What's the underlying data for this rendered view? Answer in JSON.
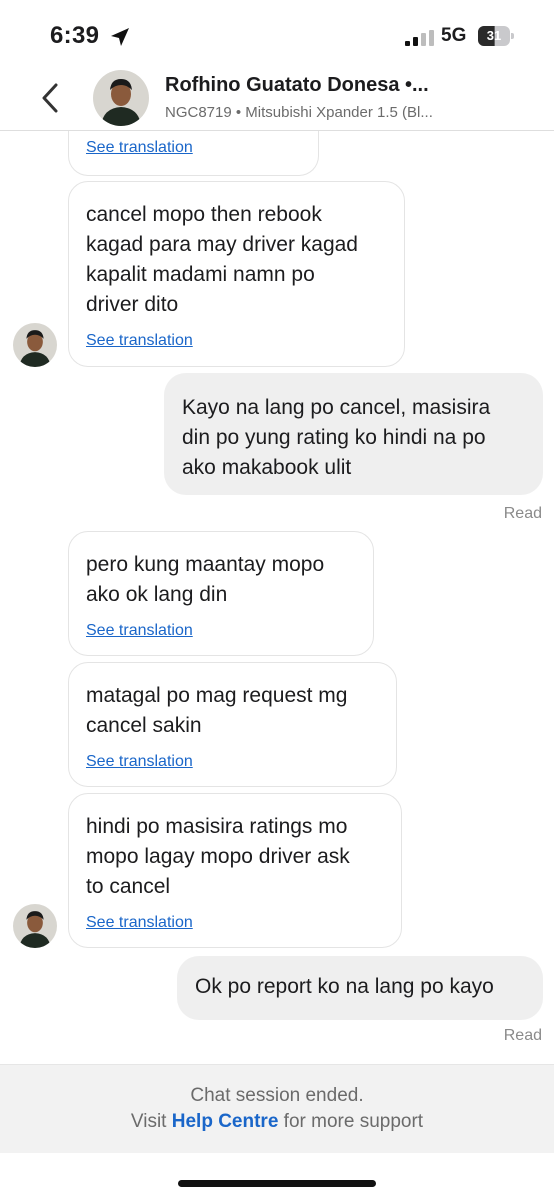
{
  "status_bar": {
    "time": "6:39",
    "network": "5G",
    "battery": "31"
  },
  "header": {
    "name": "Rofhino Guatato Donesa •...",
    "subtitle": "NGC8719 • Mitsubishi Xpander 1.5 (Bl..."
  },
  "messages": [
    {
      "direction": "incoming",
      "text": "",
      "translation": "See translation"
    },
    {
      "direction": "incoming",
      "text": "cancel mopo then rebook\nkagad para may driver kagad\nkapalit madami namn po\ndriver dito",
      "translation": "See translation"
    },
    {
      "direction": "outgoing",
      "text": "Kayo na lang po cancel, masisira\ndin po yung rating ko hindi na po\nako makabook ulit",
      "receipt": "Read"
    },
    {
      "direction": "incoming",
      "text": "pero kung maantay mopo\nako ok lang din",
      "translation": "See translation"
    },
    {
      "direction": "incoming",
      "text": "matagal po mag request mg\ncancel sakin",
      "translation": "See translation"
    },
    {
      "direction": "incoming",
      "text": "hindi po masisira ratings mo\nmopo lagay mopo driver ask\nto cancel",
      "translation": "See translation"
    },
    {
      "direction": "outgoing",
      "text": "Ok po report ko na lang po kayo",
      "receipt": "Read"
    }
  ],
  "footer": {
    "ended": "Chat session ended.",
    "visit_prefix": "Visit",
    "help_link": "Help Centre",
    "visit_suffix": "for more support"
  },
  "colors": {
    "link": "#1a66c9",
    "outgoing_bubble": "#efefef",
    "incoming_border": "#e4e4e4"
  }
}
